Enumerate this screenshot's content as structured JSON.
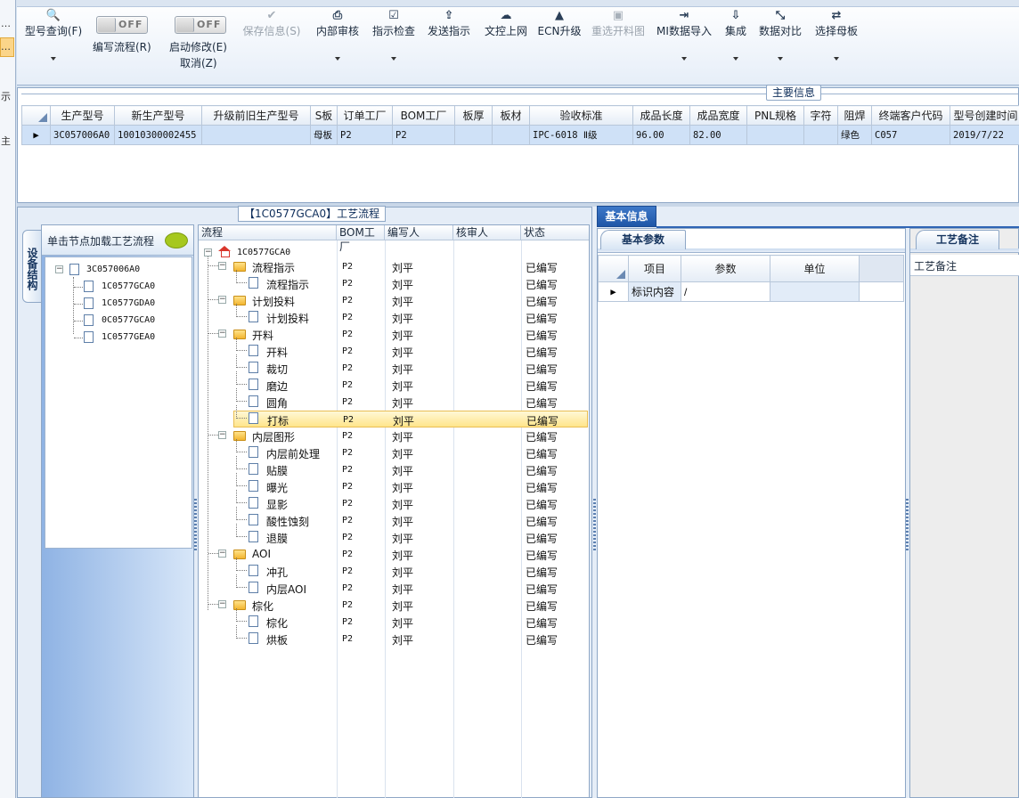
{
  "left_strip": {
    "items": [
      "…",
      "…",
      "示",
      "主"
    ]
  },
  "toolbar": {
    "buttons": [
      {
        "label": "型号查询(F)",
        "icon": "search-icon",
        "glyph": "🔍",
        "disabled": false,
        "dropdown": true
      },
      {
        "label": "保存信息(S)",
        "icon": "check-icon",
        "glyph": "✔",
        "disabled": true,
        "dropdown": false
      },
      {
        "label": "内部审核",
        "icon": "print-icon",
        "glyph": "⎙",
        "disabled": false,
        "dropdown": true
      },
      {
        "label": "指示检查",
        "icon": "checkbox-icon",
        "glyph": "☑",
        "disabled": false,
        "dropdown": true
      },
      {
        "label": "发送指示",
        "icon": "upload-icon",
        "glyph": "⇪",
        "disabled": false,
        "dropdown": false
      },
      {
        "label": "文控上网",
        "icon": "cloud-upload-icon",
        "glyph": "☁",
        "disabled": false,
        "dropdown": false
      },
      {
        "label": "ECN升级",
        "icon": "road-icon",
        "glyph": "▲",
        "disabled": false,
        "dropdown": false
      },
      {
        "label": "重选开料图",
        "icon": "image-icon",
        "glyph": "▣",
        "disabled": true,
        "dropdown": false
      },
      {
        "label": "MI数据导入",
        "icon": "sign-in-icon",
        "glyph": "⇥",
        "disabled": false,
        "dropdown": true
      },
      {
        "label": "集成",
        "icon": "download-icon",
        "glyph": "⇩",
        "disabled": false,
        "dropdown": true
      },
      {
        "label": "数据对比",
        "icon": "compress-icon",
        "glyph": "⤡",
        "disabled": false,
        "dropdown": true
      },
      {
        "label": "选择母板",
        "icon": "shuffle-icon",
        "glyph": "⇄",
        "disabled": false,
        "dropdown": true
      }
    ],
    "toggle_write": {
      "state": "OFF",
      "label": "编写流程(R)"
    },
    "toggle_start": {
      "state": "OFF",
      "label": "启动修改(E)",
      "sublabel": "取消(Z)"
    }
  },
  "main_info": {
    "caption": "主要信息",
    "columns": [
      "生产型号",
      "新生产型号",
      "升级前旧生产型号",
      "S板",
      "订单工厂",
      "BOM工厂",
      "板厚",
      "板材",
      "验收标准",
      "成品长度",
      "成品宽度",
      "PNL规格",
      "字符",
      "阻焊",
      "终端客户代码",
      "型号创建时间"
    ],
    "rows": [
      [
        "3C057006A0",
        "10010300002455",
        "",
        "母板",
        "P2",
        "P2",
        "",
        "",
        "IPC-6018 Ⅱ级",
        "96.00",
        "82.00",
        "",
        "",
        "绿色",
        "C057",
        "2019/7/22"
      ]
    ]
  },
  "side": {
    "tab_label": "设备结构",
    "header": "单击节点加载工艺流程",
    "root": "3C057006A0",
    "children": [
      "1C0577GCA0",
      "1C0577GDA0",
      "0C0577GCA0",
      "1C0577GEA0"
    ]
  },
  "flow": {
    "caption": "【1C0577GCA0】工艺流程",
    "columns": [
      "流程",
      "BOM工厂",
      "编写人",
      "核审人",
      "状态"
    ],
    "root": "1C0577GCA0",
    "rows": [
      {
        "name": "流程指示",
        "level": 1,
        "folder": true,
        "bom": "P2",
        "writer": "刘平",
        "reviewer": "",
        "status": "已编写"
      },
      {
        "name": "流程指示",
        "level": 2,
        "folder": false,
        "bom": "P2",
        "writer": "刘平",
        "reviewer": "",
        "status": "已编写"
      },
      {
        "name": "计划投料",
        "level": 1,
        "folder": true,
        "bom": "P2",
        "writer": "刘平",
        "reviewer": "",
        "status": "已编写"
      },
      {
        "name": "计划投料",
        "level": 2,
        "folder": false,
        "bom": "P2",
        "writer": "刘平",
        "reviewer": "",
        "status": "已编写"
      },
      {
        "name": "开料",
        "level": 1,
        "folder": true,
        "bom": "P2",
        "writer": "刘平",
        "reviewer": "",
        "status": "已编写"
      },
      {
        "name": "开料",
        "level": 2,
        "folder": false,
        "bom": "P2",
        "writer": "刘平",
        "reviewer": "",
        "status": "已编写"
      },
      {
        "name": "裁切",
        "level": 2,
        "folder": false,
        "bom": "P2",
        "writer": "刘平",
        "reviewer": "",
        "status": "已编写"
      },
      {
        "name": "磨边",
        "level": 2,
        "folder": false,
        "bom": "P2",
        "writer": "刘平",
        "reviewer": "",
        "status": "已编写"
      },
      {
        "name": "圆角",
        "level": 2,
        "folder": false,
        "bom": "P2",
        "writer": "刘平",
        "reviewer": "",
        "status": "已编写"
      },
      {
        "name": "打标",
        "level": 2,
        "folder": false,
        "bom": "P2",
        "writer": "刘平",
        "reviewer": "",
        "status": "已编写",
        "selected": true
      },
      {
        "name": "内层图形",
        "level": 1,
        "folder": true,
        "bom": "P2",
        "writer": "刘平",
        "reviewer": "",
        "status": "已编写"
      },
      {
        "name": "内层前处理",
        "level": 2,
        "folder": false,
        "bom": "P2",
        "writer": "刘平",
        "reviewer": "",
        "status": "已编写"
      },
      {
        "name": "贴膜",
        "level": 2,
        "folder": false,
        "bom": "P2",
        "writer": "刘平",
        "reviewer": "",
        "status": "已编写"
      },
      {
        "name": "曝光",
        "level": 2,
        "folder": false,
        "bom": "P2",
        "writer": "刘平",
        "reviewer": "",
        "status": "已编写"
      },
      {
        "name": "显影",
        "level": 2,
        "folder": false,
        "bom": "P2",
        "writer": "刘平",
        "reviewer": "",
        "status": "已编写"
      },
      {
        "name": "酸性蚀刻",
        "level": 2,
        "folder": false,
        "bom": "P2",
        "writer": "刘平",
        "reviewer": "",
        "status": "已编写"
      },
      {
        "name": "退膜",
        "level": 2,
        "folder": false,
        "bom": "P2",
        "writer": "刘平",
        "reviewer": "",
        "status": "已编写"
      },
      {
        "name": "AOI",
        "level": 1,
        "folder": true,
        "bom": "P2",
        "writer": "刘平",
        "reviewer": "",
        "status": "已编写"
      },
      {
        "name": "冲孔",
        "level": 2,
        "folder": false,
        "bom": "P2",
        "writer": "刘平",
        "reviewer": "",
        "status": "已编写"
      },
      {
        "name": "内层AOI",
        "level": 2,
        "folder": false,
        "bom": "P2",
        "writer": "刘平",
        "reviewer": "",
        "status": "已编写"
      },
      {
        "name": "棕化",
        "level": 1,
        "folder": true,
        "bom": "P2",
        "writer": "刘平",
        "reviewer": "",
        "status": "已编写"
      },
      {
        "name": "棕化",
        "level": 2,
        "folder": false,
        "bom": "P2",
        "writer": "刘平",
        "reviewer": "",
        "status": "已编写"
      },
      {
        "name": "烘板",
        "level": 2,
        "folder": false,
        "bom": "P2",
        "writer": "刘平",
        "reviewer": "",
        "status": "已编写"
      }
    ]
  },
  "basic": {
    "tab_label": "基本信息",
    "params_tab": "基本参数",
    "columns": [
      "项目",
      "参数",
      "单位"
    ],
    "rows": [
      [
        "标识内容",
        "/",
        ""
      ]
    ],
    "notes_tab": "工艺备注",
    "notes_label": "工艺备注"
  }
}
